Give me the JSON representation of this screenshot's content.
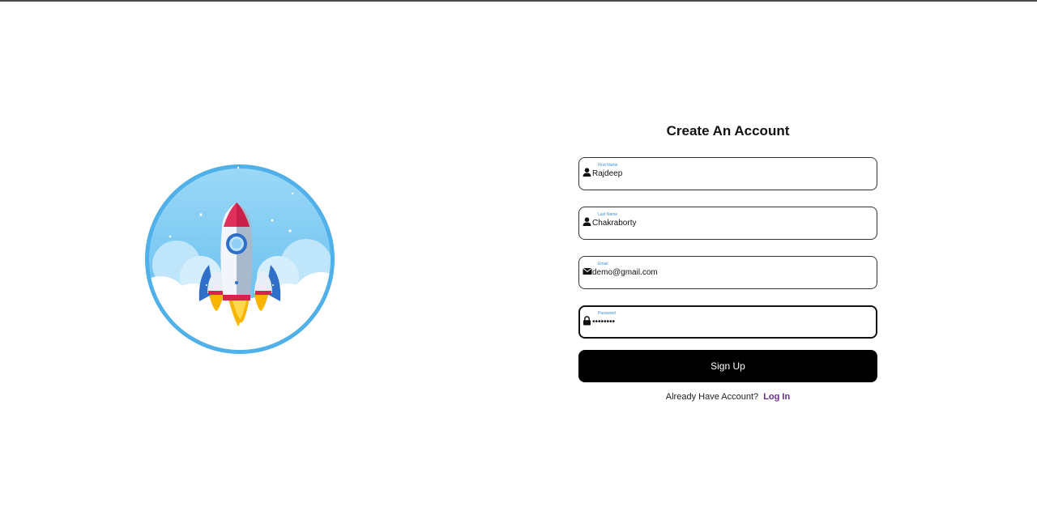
{
  "form": {
    "title": "Create An Account",
    "fields": [
      {
        "label": "First Name",
        "value": "Rajdeep",
        "icon": "user-icon"
      },
      {
        "label": "Last Name",
        "value": "Chakraborty",
        "icon": "user-icon"
      },
      {
        "label": "Email",
        "value": "demo@gmail.com",
        "icon": "envelope-icon"
      },
      {
        "label": "Password",
        "value": "password",
        "icon": "lock-icon"
      }
    ],
    "submit_label": "Sign Up",
    "footer_text": "Already Have Account?",
    "login_label": "Log In"
  },
  "colors": {
    "button_bg": "#000000",
    "link": "#6a2a8a",
    "label": "#3b8fd9"
  }
}
